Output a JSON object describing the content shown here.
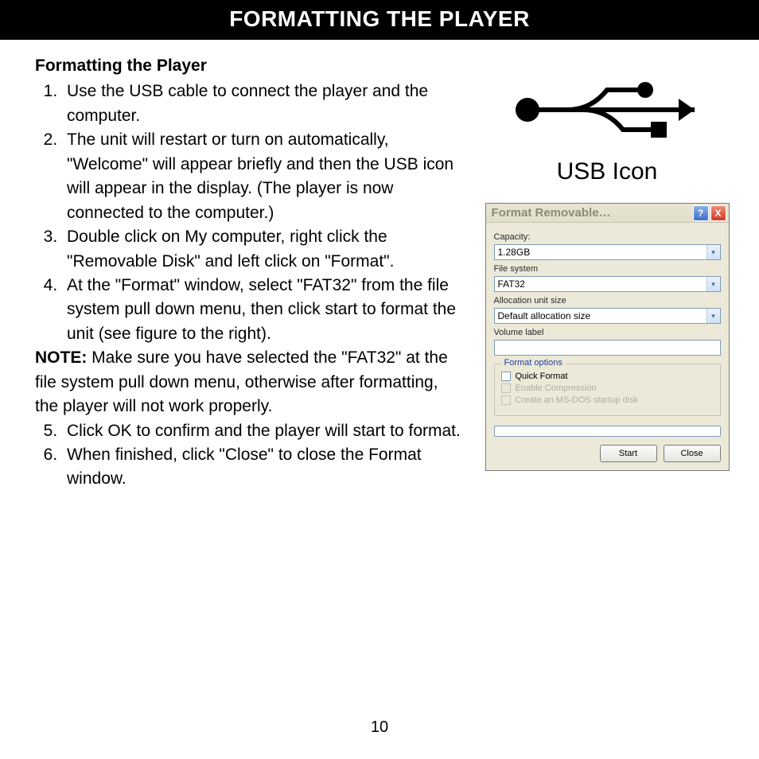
{
  "title_bar": "FORMATTING THE PLAYER",
  "subheading": "Formatting the Player",
  "steps": {
    "s1": "Use the USB cable to connect the player and the computer.",
    "s2": "The unit will restart or turn on automatically, \"Welcome\" will appear briefly and then the USB icon will appear in the display. (The player is now connected to the computer.)",
    "s3": "Double click on My computer, right click the \"Removable Disk\" and left click on \"Format\".",
    "s4": "At the \"Format\" window, select \"FAT32\" from the file system pull down menu, then click start to format the unit (see figure to the right).",
    "s5": "Click OK to confirm and the player will start to format.",
    "s6": "When finished, click \"Close\" to close the Format window."
  },
  "note_label": "NOTE:",
  "note_text": " Make sure you have selected the \"FAT32\" at the file system pull down menu, otherwise after formatting, the player will not work properly.",
  "usb_caption": "USB Icon",
  "dialog": {
    "title": "Format Removable…",
    "help": "?",
    "close": "X",
    "capacity_label": "Capacity:",
    "capacity_value": "1.28GB",
    "filesystem_label": "File system",
    "filesystem_value": "FAT32",
    "alloc_label": "Allocation unit size",
    "alloc_value": "Default allocation size",
    "volume_label": "Volume label",
    "volume_value": "",
    "options_legend": "Format options",
    "quick_format": "Quick Format",
    "enable_compression": "Enable Compression",
    "msdos": "Create an MS-DOS startup disk",
    "start_btn": "Start",
    "close_btn": "Close"
  },
  "page_number": "10"
}
